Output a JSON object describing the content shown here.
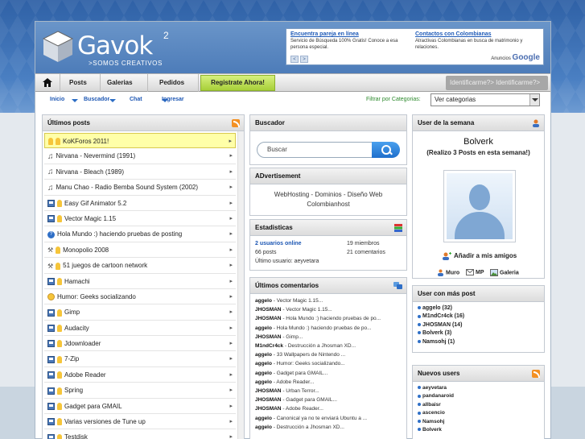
{
  "site": {
    "logo_text": "Gavok",
    "logo_sup": "2",
    "tagline": ">SOMOS CREATIVOS"
  },
  "ad": {
    "col1": {
      "title": "Encuentra pareja en línea",
      "desc": "Servicio de Búsqueda 100% Gratis! Conoce a esa persona especial."
    },
    "col2": {
      "title": "Contactos con Colombianas",
      "desc": "Atractivas Colombianas en busca de matrimonio y relaciones."
    },
    "prev": "<",
    "next": ">",
    "brand_prefix": "Anuncios",
    "brand_name": "Google"
  },
  "nav": {
    "items": [
      {
        "label": "Posts"
      },
      {
        "label": "Galerias"
      },
      {
        "label": "Pedidos"
      }
    ],
    "register": "Registrate Ahora!",
    "identify": "Identificarme?> Identificarme?>"
  },
  "subnav": {
    "links": [
      "Inicio",
      "Buscador",
      "Chat",
      "Ingresar"
    ],
    "filter_label": "Filtrar por Categorias:",
    "select_value": "Ver categorias"
  },
  "latest_posts": {
    "title": "Últimos posts",
    "items": [
      {
        "icon": "diamond",
        "label": "KoKForos 2011!"
      },
      {
        "icon": "note",
        "label": "Nirvana - Nevermind (1991)"
      },
      {
        "icon": "note",
        "label": "Nirvana - Bleach (1989)"
      },
      {
        "icon": "note",
        "label": "Manu Chao - Radio Bemba Sound System (2002)"
      },
      {
        "icon": "disk",
        "label": "Easy Gif Animator 5.2"
      },
      {
        "icon": "disk",
        "label": "Vector Magic 1.15"
      },
      {
        "icon": "help",
        "label": "Hola Mundo :) haciendo pruebas de posting"
      },
      {
        "icon": "tool",
        "label": "Monopolio 2008"
      },
      {
        "icon": "tool",
        "label": "51 juegos de cartoon network"
      },
      {
        "icon": "disk",
        "label": "Hamachi"
      },
      {
        "icon": "smile",
        "label": "Humor: Geeks socializando"
      },
      {
        "icon": "disk",
        "label": "Gimp"
      },
      {
        "icon": "disk",
        "label": "Audacity"
      },
      {
        "icon": "disk",
        "label": "Jdownloader"
      },
      {
        "icon": "disk",
        "label": "7-Zip"
      },
      {
        "icon": "disk",
        "label": "Adobe Reader"
      },
      {
        "icon": "disk",
        "label": "Spring"
      },
      {
        "icon": "disk",
        "label": "Gadget para GMAIL"
      },
      {
        "icon": "disk",
        "label": "Varias versiones de Tune up"
      },
      {
        "icon": "disk",
        "label": "Testdisk"
      }
    ]
  },
  "search": {
    "title": "Buscador",
    "placeholder": "Buscar"
  },
  "advert": {
    "title": "ADvertisement",
    "line1": "WebHosting - Dominios - Diseño Web",
    "line2": "Colombianhost"
  },
  "stats": {
    "title": "Estadisticas",
    "online": "2 usuarios online",
    "members": "19 miembros",
    "posts": "66 posts",
    "comments": "21 comentarios",
    "last_user": "Último usuario: aeyvetara"
  },
  "comments": {
    "title": "Últimos comentarios",
    "items": [
      {
        "user": "aggelo",
        "text": " - Vector Magic 1.15..."
      },
      {
        "user": "JHOSMAN",
        "text": " - Vector Magic 1.15..."
      },
      {
        "user": "JHOSMAN",
        "text": " - Hola Mundo :) haciendo pruebas de po..."
      },
      {
        "user": "aggelo",
        "text": " - Hola Mundo :) haciendo pruebas de po..."
      },
      {
        "user": "JHOSMAN",
        "text": " - Gimp..."
      },
      {
        "user": "M1ndCr4ck",
        "text": " - Destrucción a Jhosman XD..."
      },
      {
        "user": "aggelo",
        "text": " - 33 Wallpapers de Nintendo ..."
      },
      {
        "user": "aggelo",
        "text": " - Humor: Geeks socializando..."
      },
      {
        "user": "aggelo",
        "text": " - Gadget para GMAIL..."
      },
      {
        "user": "aggelo",
        "text": " - Adobe Reader..."
      },
      {
        "user": "JHOSMAN",
        "text": " - Urban Terror..."
      },
      {
        "user": "JHOSMAN",
        "text": " - Gadget para GMAIL..."
      },
      {
        "user": "JHOSMAN",
        "text": " - Adobe Reader..."
      },
      {
        "user": "aggelo",
        "text": " - Canonical ya no te enviará Ubuntu a ..."
      },
      {
        "user": "aggelo",
        "text": " - Destrucción a Jhosman XD..."
      }
    ]
  },
  "user_week": {
    "title": "User de la semana",
    "name": "Bolverk",
    "sub": "(Realizo 3 Posts en esta semana!)",
    "add_friend": "Añadir a mis amigos",
    "links": [
      "Muro",
      "MP",
      "Galeria"
    ]
  },
  "top_users": {
    "title": "User con más post",
    "items": [
      "aggelo (32)",
      "M1ndCr4ck (16)",
      "JHOSMAN (14)",
      "Bolverk (3)",
      "Namsohj (1)"
    ]
  },
  "new_users": {
    "title": "Nuevos users",
    "items": [
      "aeyvetara",
      "pandanaroid",
      "allbaisr",
      "ascencio",
      "Namsohj",
      "Bolverk"
    ]
  }
}
